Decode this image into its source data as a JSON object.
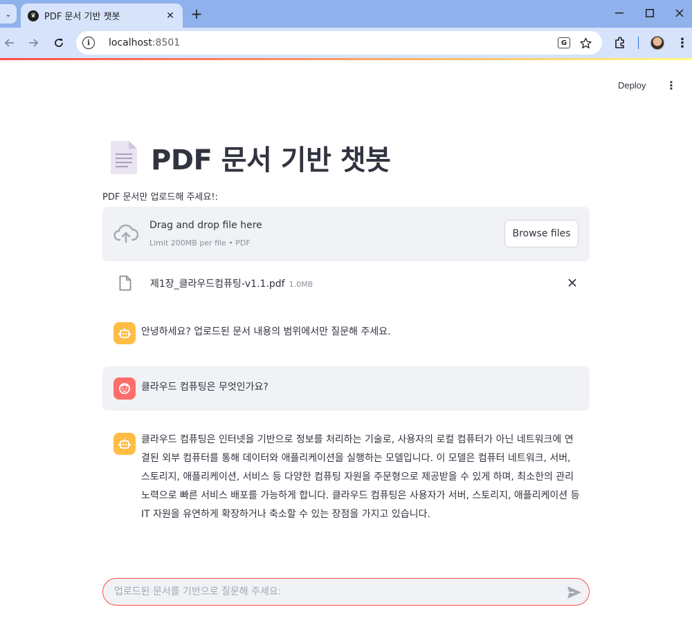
{
  "browser": {
    "tab_title": "PDF 문서 기반 챗봇",
    "tab_close": "✕",
    "new_tab": "+",
    "url_host": "localhost",
    "url_port": ":8501",
    "icons": [
      "tab-search-icon",
      "app-favicon",
      "back-icon",
      "forward-icon",
      "reload-icon",
      "site-info-icon",
      "translate-icon",
      "bookmark-star-icon",
      "extensions-icon",
      "profile-avatar",
      "browser-menu-icon",
      "minimize-icon",
      "maximize-icon",
      "close-window-icon"
    ]
  },
  "app": {
    "deploy_label": "Deploy",
    "title": "PDF 문서 기반 챗봇",
    "uploader": {
      "label": "PDF 문서만 업로드해 주세요!:",
      "drop_title": "Drag and drop file here",
      "drop_sub": "Limit 200MB per file • PDF",
      "browse_label": "Browse files"
    },
    "file": {
      "name": "제1장_클라우드컴퓨팅-v1.1.pdf",
      "size": "1.0MB"
    },
    "messages": [
      {
        "role": "assistant",
        "text": "안녕하세요? 업로드된 문서 내용의 범위에서만 질문해 주세요."
      },
      {
        "role": "user",
        "text": "클라우드 컴퓨팅은 무엇인가요?"
      },
      {
        "role": "assistant",
        "text": "클라우드 컴퓨팅은 인터넷을 기반으로 정보를 처리하는 기술로, 사용자의 로컬 컴퓨터가 아닌 네트워크에 연결된 외부 컴퓨터를 통해 데이터와 애플리케이션을 실행하는 모델입니다. 이 모델은 컴퓨터 네트워크, 서버, 스토리지, 애플리케이션, 서비스 등 다양한 컴퓨팅 자원을 주문형으로 제공받을 수 있게 하며, 최소한의 관리 노력으로 빠른 서비스 배포를 가능하게 합니다. 클라우드 컴퓨팅은 사용자가 서버, 스토리지, 애플리케이션 등 IT 자원을 유연하게 확장하거나 축소할 수 있는 장점을 가지고 있습니다."
      }
    ],
    "chat_input": {
      "placeholder": "업로드된 문서를 기반으로 질문해 주세요:",
      "value": ""
    },
    "colors": {
      "accent": "#ff4b4b",
      "bot_avatar": "#ffbd45",
      "user_avatar": "#ff6c6c",
      "surface": "#f0f2f6",
      "text": "#31333f"
    }
  }
}
